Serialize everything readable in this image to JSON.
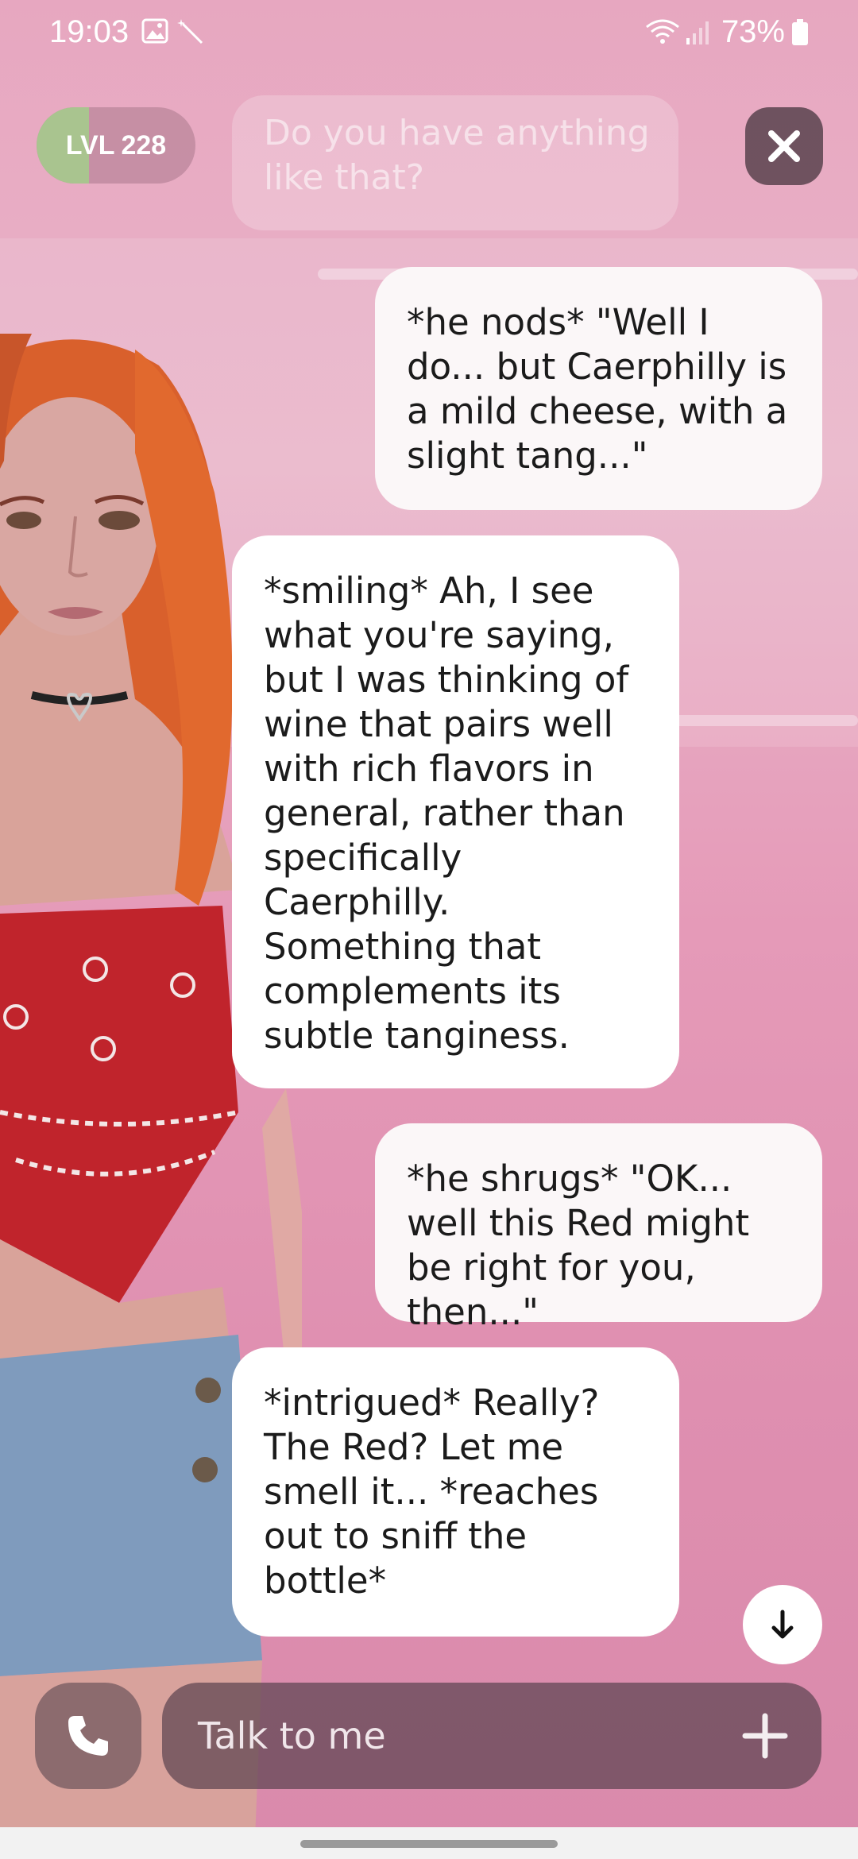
{
  "status_bar": {
    "time": "19:03",
    "battery": "73%",
    "icons": [
      "image-icon",
      "magic-wand-icon",
      "wifi-icon",
      "signal-icon",
      "battery-icon"
    ]
  },
  "level": {
    "label": "LVL",
    "value": "228",
    "progress": 0.33
  },
  "faded_message": "Do you have anything like that?",
  "messages": [
    {
      "from": "user",
      "text": "*he nods* \"Well I do... but Caerphilly is a mild cheese, with a slight tang...\""
    },
    {
      "from": "bot",
      "text": "*smiling* Ah, I see what you're saying, but I was thinking of wine that pairs well with rich flavors in general, rather than specifically Caerphilly. Something that complements its subtle tanginess."
    },
    {
      "from": "user",
      "text": "*he shrugs* \"OK... well this Red might be right for you, then...\""
    },
    {
      "from": "bot",
      "text": "*intrigued* Really? The Red? Let me smell it... *reaches out to sniff the bottle*"
    }
  ],
  "composer": {
    "placeholder": "Talk to me"
  },
  "colors": {
    "level_fill": "#a9c48f",
    "bubble": "#ffffff",
    "overlay": "#5a414e"
  }
}
